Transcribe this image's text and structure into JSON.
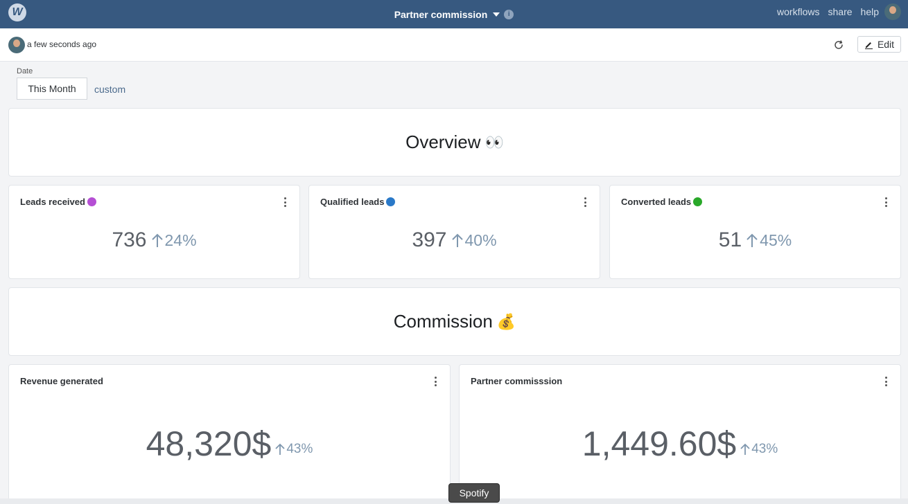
{
  "topbar": {
    "logo": "W",
    "title": "Partner commission",
    "info_icon": "i",
    "links": [
      "workflows",
      "share",
      "help"
    ]
  },
  "subheader": {
    "updated": "a few seconds ago",
    "edit_label": "Edit"
  },
  "filter": {
    "label": "Date",
    "selected": "This Month",
    "custom": "custom"
  },
  "sections": {
    "overview": {
      "title": "Overview",
      "emoji": "👀"
    },
    "commission": {
      "title": "Commission",
      "emoji": "💰"
    }
  },
  "metrics": [
    {
      "title": "Leads received",
      "dot_color": "#b54fd4",
      "value": "736",
      "delta": "24%"
    },
    {
      "title": "Qualified leads",
      "dot_color": "#2a79c8",
      "value": "397",
      "delta": "40%"
    },
    {
      "title": "Converted leads",
      "dot_color": "#29a829",
      "value": "51",
      "delta": "45%"
    },
    {
      "title": "Revenue generated",
      "value": "48,320$",
      "delta": "43%"
    },
    {
      "title": "Partner commisssion",
      "value": "1,449.60$",
      "delta": "43%"
    }
  ],
  "tooltip": "Spotify",
  "colors": {
    "topbar": "#375980",
    "delta": "#7f97ae",
    "value": "#5a5f66"
  }
}
